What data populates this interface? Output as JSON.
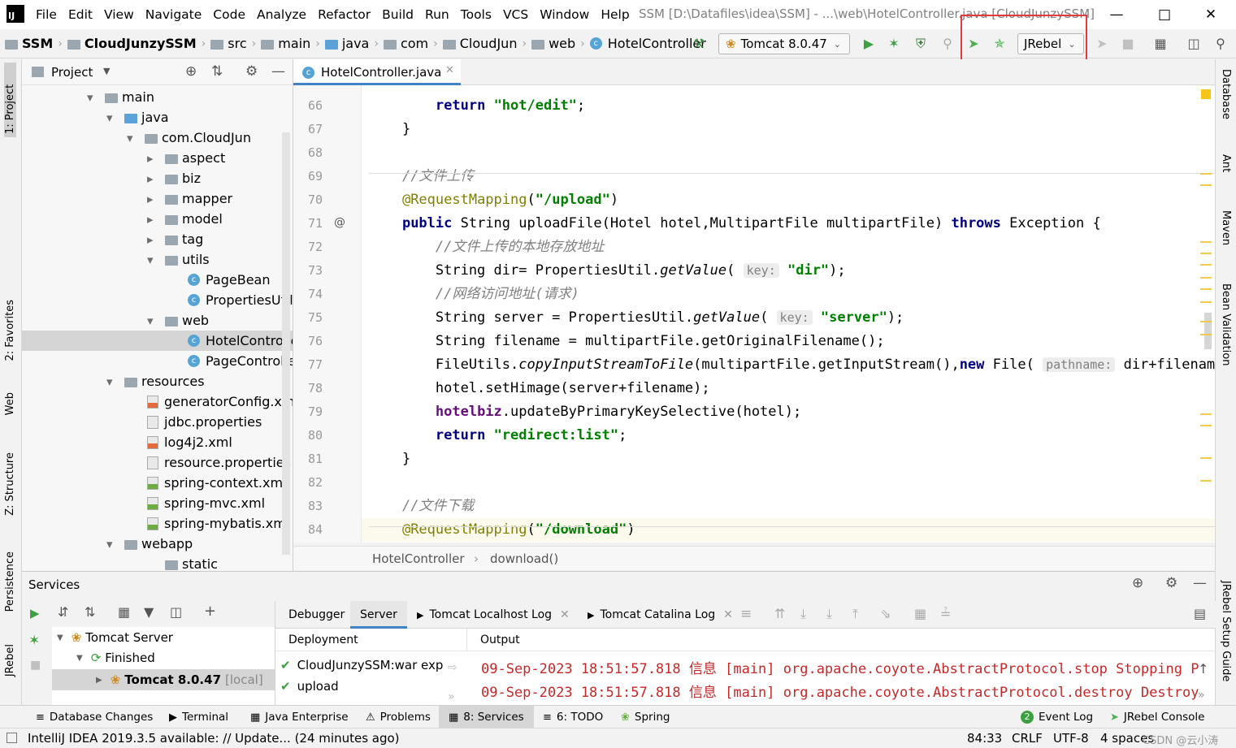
{
  "menubar": {
    "items": [
      "File",
      "Edit",
      "View",
      "Navigate",
      "Code",
      "Analyze",
      "Refactor",
      "Build",
      "Run",
      "Tools",
      "VCS",
      "Window",
      "Help"
    ],
    "title": "SSM [D:\\Datafiles\\idea\\SSM] - ...\\web\\HotelController.java [CloudJunzySSM]"
  },
  "navbar": {
    "crumbs": [
      "SSM",
      "CloudJunzySSM",
      "src",
      "main",
      "java",
      "com",
      "CloudJun",
      "web",
      "HotelController"
    ],
    "run_config": "Tomcat 8.0.47",
    "jrebel_select": "JRebel"
  },
  "left_stripe": [
    "1: Project",
    "2: Favorites",
    "Web",
    "Z: Structure",
    "Persistence",
    "JRebel"
  ],
  "right_stripe": [
    "Database",
    "Ant",
    "Maven",
    "Bean Validation",
    "JRebel Setup Guide"
  ],
  "project": {
    "header": "Project",
    "tree": [
      {
        "label": "main",
        "kind": "folder",
        "open": true
      },
      {
        "label": "java",
        "kind": "folder",
        "open": true
      },
      {
        "label": "com.CloudJun",
        "kind": "folder",
        "open": true
      },
      {
        "label": "aspect",
        "kind": "folder",
        "open": false
      },
      {
        "label": "biz",
        "kind": "folder",
        "open": false
      },
      {
        "label": "mapper",
        "kind": "folder",
        "open": false
      },
      {
        "label": "model",
        "kind": "folder",
        "open": false
      },
      {
        "label": "tag",
        "kind": "folder",
        "open": false
      },
      {
        "label": "utils",
        "kind": "folder",
        "open": true
      },
      {
        "label": "PageBean",
        "kind": "class"
      },
      {
        "label": "PropertiesUtil",
        "kind": "class"
      },
      {
        "label": "web",
        "kind": "folder",
        "open": true
      },
      {
        "label": "HotelController",
        "kind": "class",
        "selected": true
      },
      {
        "label": "PageController",
        "kind": "class"
      },
      {
        "label": "resources",
        "kind": "folder",
        "open": true
      },
      {
        "label": "generatorConfig.xml",
        "kind": "xml"
      },
      {
        "label": "jdbc.properties",
        "kind": "props"
      },
      {
        "label": "log4j2.xml",
        "kind": "xml"
      },
      {
        "label": "resource.properties",
        "kind": "props"
      },
      {
        "label": "spring-context.xml",
        "kind": "spring"
      },
      {
        "label": "spring-mvc.xml",
        "kind": "spring"
      },
      {
        "label": "spring-mybatis.xml",
        "kind": "spring"
      },
      {
        "label": "webapp",
        "kind": "folder",
        "open": true
      },
      {
        "label": "static",
        "kind": "folder"
      }
    ]
  },
  "editor": {
    "tab": "HotelController.java",
    "lines": [
      {
        "n": "66",
        "html": "        <span class=\"kw\">return</span> <span class=\"str\">\"hot/edit\"</span>;"
      },
      {
        "n": "67",
        "html": "    }"
      },
      {
        "n": "68",
        "html": ""
      },
      {
        "n": "69",
        "html": "    <span class=\"cm\">//文件上传</span>"
      },
      {
        "n": "70",
        "html": "    <span class=\"an\">@RequestMapping</span>(<span class=\"str\">\"/upload\"</span>)"
      },
      {
        "n": "71",
        "html": "    <span class=\"kw\">public</span> String uploadFile(Hotel hotel,MultipartFile multipartFile) <span class=\"kw\">throws</span> Exception {"
      },
      {
        "n": "72",
        "html": "        <span class=\"cm\">//文件上传的本地存放地址</span>"
      },
      {
        "n": "73",
        "html": "        String dir= PropertiesUtil.<span class=\"it\">getValue</span>( <span class=\"hint\">key:</span> <span class=\"str\">\"dir\"</span>);"
      },
      {
        "n": "74",
        "html": "        <span class=\"cm\">//网络访问地址(请求)</span>"
      },
      {
        "n": "75",
        "html": "        String server = PropertiesUtil.<span class=\"it\">getValue</span>( <span class=\"hint\">key:</span> <span class=\"str\">\"server\"</span>);"
      },
      {
        "n": "76",
        "html": "        String filename = multipartFile.getOriginalFilename();"
      },
      {
        "n": "77",
        "html": "        FileUtils.<span class=\"it\">copyInputStreamToFile</span>(multipartFile.getInputStream(),<span class=\"kw\">new</span> File( <span class=\"hint\">pathname:</span> dir+filename));"
      },
      {
        "n": "78",
        "html": "        hotel.setHimage(server+filename);"
      },
      {
        "n": "79",
        "html": "        <span class=\"fld\">hotelbiz</span>.updateByPrimaryKeySelective(hotel);"
      },
      {
        "n": "80",
        "html": "        <span class=\"kw\">return</span> <span class=\"str\">\"redirect:list\"</span>;"
      },
      {
        "n": "81",
        "html": "    }"
      },
      {
        "n": "82",
        "html": ""
      },
      {
        "n": "83",
        "html": "    <span class=\"cm\">//文件下载</span>"
      },
      {
        "n": "84",
        "html": "    <span class=\"an\">@RequestMapping</span>(<span class=\"str\">\"/download\"</span>)"
      }
    ],
    "breadcrumb": [
      "HotelController",
      "download()"
    ]
  },
  "services": {
    "title": "Services",
    "tree": [
      {
        "label": "Tomcat Server"
      },
      {
        "label": "Finished"
      },
      {
        "label": "Tomcat 8.0.47",
        "suffix": "[local]"
      }
    ],
    "tabs": [
      "Debugger",
      "Server",
      "Tomcat Localhost Log",
      "Tomcat Catalina Log"
    ],
    "deployment_header": "Deployment",
    "output_header": "Output",
    "deployments": [
      "CloudJunzySSM:war exp",
      "upload"
    ],
    "log_lines": [
      "09-Sep-2023 18:51:57.818 信息 [main] org.apache.coyote.AbstractProtocol.stop Stopping P",
      "09-Sep-2023 18:51:57.818 信息 [main] org.apache.coyote.AbstractProtocol.destroy Destroy"
    ]
  },
  "bottom_tabs": [
    "Database Changes",
    "Terminal",
    "Java Enterprise",
    "Problems",
    "8: Services",
    "6: TODO",
    "Spring",
    "Event Log",
    "JRebel Console"
  ],
  "event_log_count": "2",
  "statusbar": {
    "message": "IntelliJ IDEA 2019.3.5 available: // Update... (24 minutes ago)",
    "position": "84:33",
    "line_sep": "CRLF",
    "encoding": "UTF-8",
    "indent": "4 spaces",
    "watermark": "CSDN @云小涛"
  }
}
